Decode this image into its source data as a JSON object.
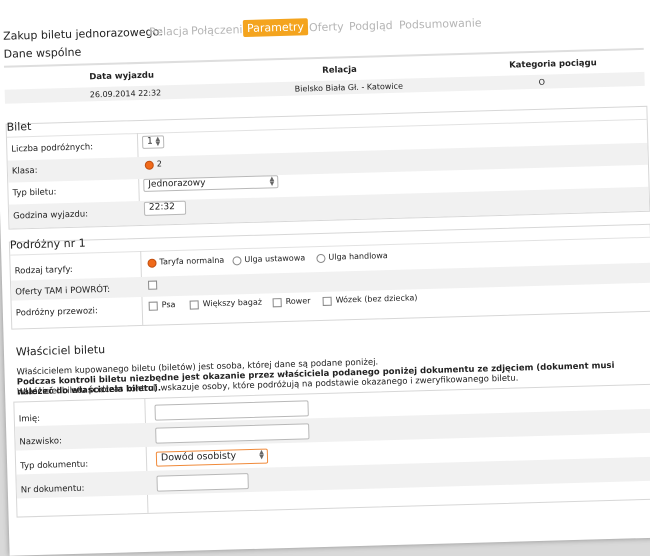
{
  "wizard": {
    "title": "Zakup biletu jednorazowego:",
    "tabs": [
      "Relacja",
      "Połączenia",
      "Parametry",
      "Oferty",
      "Podgląd",
      "Podsumowanie"
    ],
    "active": "Parametry"
  },
  "dane_wspolne": {
    "title": "Dane wspólne",
    "headers": [
      "Data wyjazdu",
      "Relacja",
      "Kategoria pociągu"
    ],
    "values": [
      "26.09.2014 22:32",
      "Bielsko Biała Gł. - Katowice",
      "O"
    ]
  },
  "bilet": {
    "title": "Bilet",
    "labels": {
      "liczba": "Liczba podróżnych:",
      "klasa": "Klasa:",
      "typ": "Typ biletu:",
      "godzina": "Godzina wyjazdu:"
    },
    "liczba_value": "1",
    "klasa_value": "2",
    "typ_value": "Jednorazowy",
    "godzina_value": "22:32"
  },
  "podrozny": {
    "title": "Podróżny nr 1",
    "labels": {
      "rodzaj": "Rodzaj taryfy:",
      "oferty": "Oferty TAM i POWRÓT:",
      "przewozi": "Podróżny przewozi:"
    },
    "taryfy": [
      "Taryfa normalna",
      "Ulga ustawowa",
      "Ulga handlowa"
    ],
    "przewozi": [
      "Psa",
      "Większy bagaż",
      "Rower",
      "Wózek (bez dziecka)"
    ]
  },
  "wlasciciel": {
    "title": "Właściciel biletu",
    "line1": "Właścicielem kupowanego biletu (biletów) jest osoba, której dane są podane poniżej.",
    "line2": "Podczas kontroli biletu niezbędne jest okazanie przez właściciela podanego poniżej dokumentu ze zdjęciem (dokument musi należeć do właściciela biletu).",
    "line3": "Właściciel biletu podczas kontroli wskazuje osoby, które podróżują na podstawie okazanego i zweryfikowanego biletu.",
    "labels": {
      "imie": "Imię:",
      "nazwisko": "Nazwisko:",
      "typdok": "Typ dokumentu:",
      "nrdok": "Nr dokumentu:"
    },
    "typdok_value": "Dowód osobisty"
  }
}
